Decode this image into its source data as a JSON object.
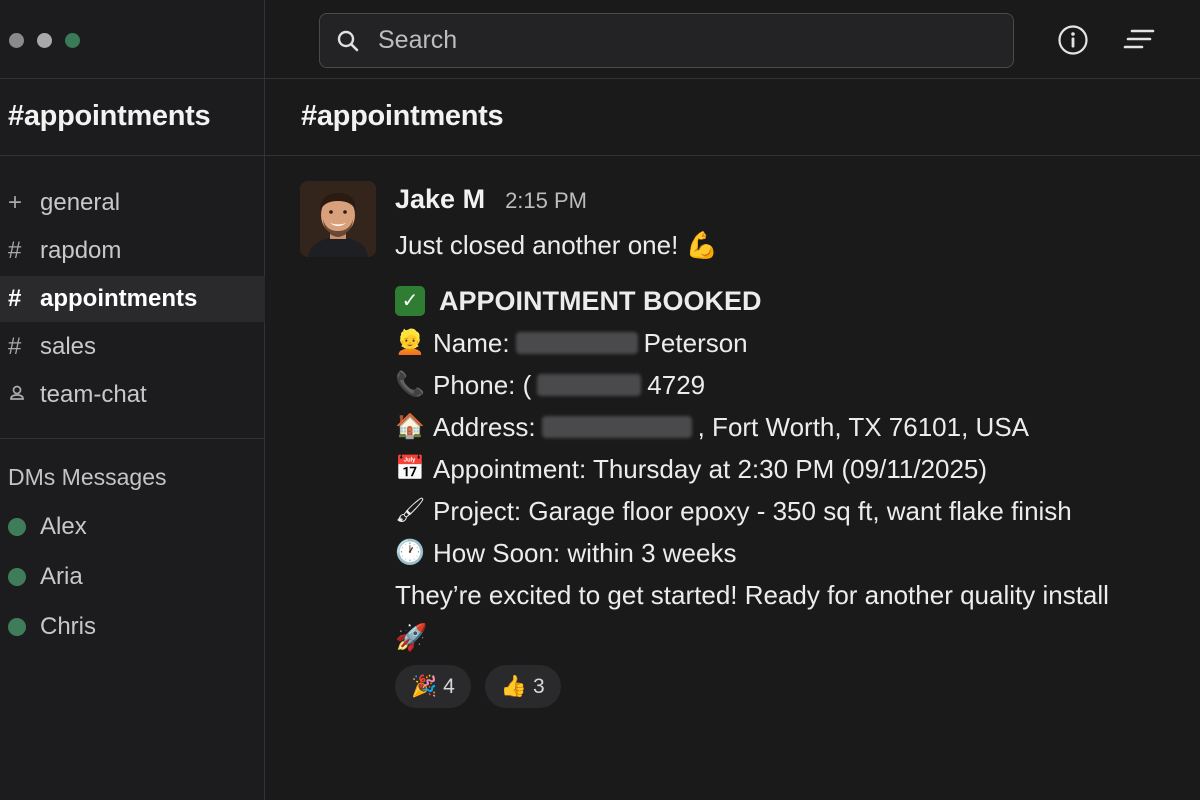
{
  "window": {
    "controls": [
      "close",
      "minimize",
      "zoom"
    ]
  },
  "search": {
    "placeholder": "Search"
  },
  "sidebar": {
    "workspace_title": "appointments",
    "channels": [
      {
        "icon": "plus",
        "label": "general",
        "active": false
      },
      {
        "icon": "hash",
        "label": "rapdom",
        "active": false
      },
      {
        "icon": "hash",
        "label": "appointments",
        "active": true
      },
      {
        "icon": "hash",
        "label": "sales",
        "active": false
      },
      {
        "icon": "person",
        "label": "team-chat",
        "active": false
      }
    ],
    "dm_header": "DMs Messages",
    "dms": [
      {
        "name": "Alex",
        "status_color": "#3f7d5a"
      },
      {
        "name": "Aria",
        "status_color": "#3f7d5a"
      },
      {
        "name": "Chris",
        "status_color": "#3f7d5a"
      }
    ]
  },
  "main": {
    "channel_title": "appointments"
  },
  "message": {
    "author": "Jake M",
    "time": "2:15 PM",
    "lines": {
      "intro": "Just closed another one! 💪",
      "booked": "APPOINTMENT BOOKED",
      "name_label": "Name:",
      "name_value": "Peterson",
      "phone_label": "Phone: (",
      "phone_value": "4729",
      "address_label": "Address:",
      "address_value": ", Fort Worth, TX 76101, USA",
      "appointment": "Appointment: Thursday at 2:30 PM (09/11/2025)",
      "project": "Project: Garage floor epoxy - 350 sq ft, want flake finish",
      "how_soon": "How Soon: within 3 weeks",
      "closing": "They’re excited to get started! Ready for another quality install",
      "closing_emoji": "🚀"
    },
    "emojis": {
      "name": "👱",
      "phone": "📞",
      "address": "🏠",
      "appointment": "📅",
      "project": "🖌",
      "how_soon": "🕐"
    }
  },
  "reactions": [
    {
      "emoji": "🎉",
      "count": "4"
    },
    {
      "emoji": "👍",
      "count": "3"
    }
  ],
  "colors": {
    "background": "#1a1a1b",
    "sidebar": "#1c1c1e",
    "active_channel": "#2a2a2c",
    "online_dot": "#3f7d5a",
    "check_green": "#2e7d32"
  }
}
